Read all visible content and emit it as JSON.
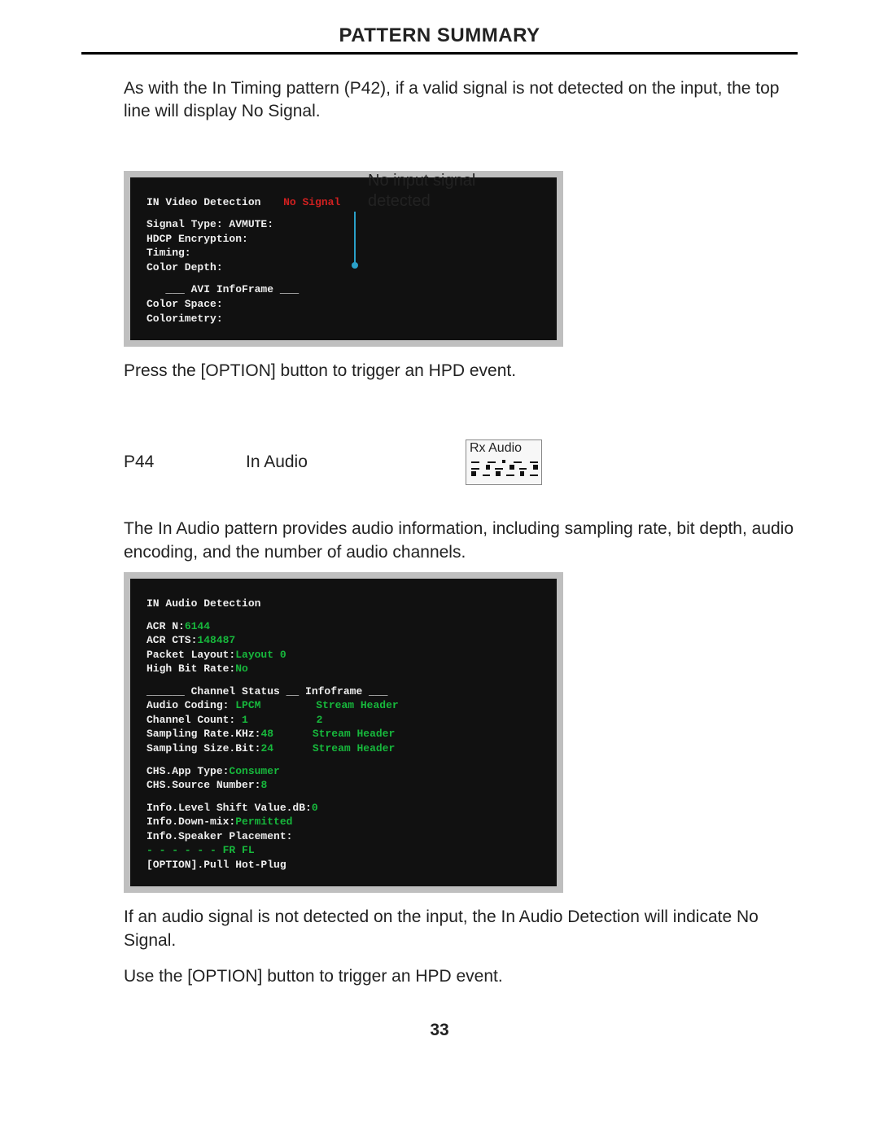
{
  "header": {
    "title": "PATTERN SUMMARY"
  },
  "intro_p1": "As with the In Timing pattern (P42), if a valid signal is not detected on the input, the top line will display No Signal.",
  "callout_label_l1": "No input signal",
  "callout_label_l2": "detected",
  "term1": {
    "l1_label": "IN Video Detection",
    "l1_value": "No Signal",
    "l2": "Signal Type:     AVMUTE:",
    "l3": "HDCP Encryption:",
    "l4": "Timing:",
    "l5": "Color Depth:",
    "l6": "___ AVI InfoFrame ___",
    "l7": "Color Space:",
    "l8": "Colorimetry:"
  },
  "press_option_1": "Press the [OPTION] button to trigger an HPD event.",
  "pattern_row": {
    "num": "P44",
    "name": "In Audio",
    "rx_label": "Rx Audio"
  },
  "in_audio_desc": "The In Audio pattern provides audio information, including sampling rate, bit depth, audio encoding, and the number of audio channels.",
  "term2": {
    "l1": "IN Audio Detection",
    "l2_label": "ACR N:",
    "l2_value": "6144",
    "l3_label": "ACR CTS:",
    "l3_value": "148487",
    "l4_label": "Packet Layout:",
    "l4_value": "Layout 0",
    "l5_label": "High Bit Rate:",
    "l5_value": "No",
    "l6": "______ Channel Status __ Infoframe ___",
    "l7_label": "Audio Coding:",
    "l7_v1": "LPCM",
    "l7_v2": "Stream Header",
    "l8_label": "Channel Count:",
    "l8_v1": "1",
    "l8_v2": "2",
    "l9_label": "Sampling Rate.KHz:",
    "l9_v1": "48",
    "l9_v2": "Stream Header",
    "l10_label": "Sampling Size.Bit:",
    "l10_v1": "24",
    "l10_v2": "Stream Header",
    "l11_label": "CHS.App Type:",
    "l11_value": "Consumer",
    "l12_label": "CHS.Source Number:",
    "l12_value": "8",
    "l13_label": "Info.Level Shift Value.dB:",
    "l13_value": "0",
    "l14_label": "Info.Down-mix:",
    "l14_value": "Permitted",
    "l15": "Info.Speaker Placement:",
    "l16_dashes": " -    -   -   -   -   -  ",
    "l16_value": "FR FL",
    "l17": "[OPTION].Pull Hot-Plug"
  },
  "after_term2_p1": "If an audio signal is not detected on the input, the In Audio Detection will indicate No Signal.",
  "after_term2_p2": "Use the [OPTION] button to trigger an HPD event.",
  "page_number": "33"
}
